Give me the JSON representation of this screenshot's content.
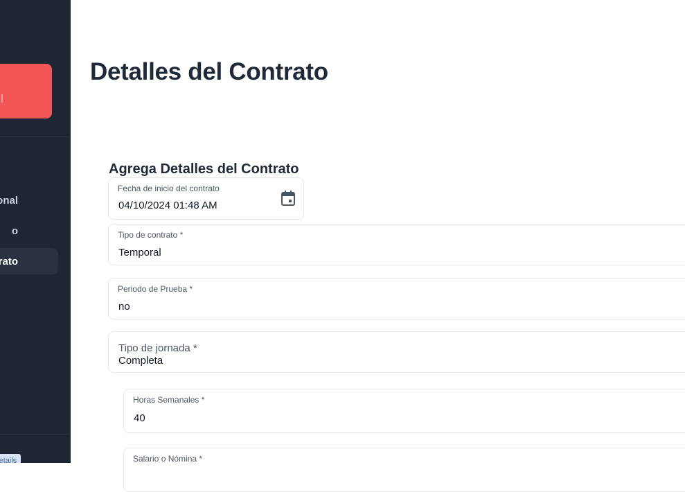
{
  "sidebar": {
    "items": [
      {
        "label": "onal"
      },
      {
        "label": "o"
      },
      {
        "label": "rato"
      }
    ],
    "tag": "actDetails"
  },
  "page": {
    "title": "Detalles del Contrato",
    "section_title": "Agrega Detalles del Contrato"
  },
  "form": {
    "start_date": {
      "label": "Fecha de inicio del contrato",
      "value": "04/10/2024 01:48 AM"
    },
    "contract_type": {
      "label": "Tipo de contrato *",
      "value": "Temporal"
    },
    "trial_period": {
      "label": "Periodo de Prueba *",
      "value": "no"
    },
    "workday_type": {
      "label": "Tipo de jornada *",
      "value": "Completa"
    },
    "weekly_hours": {
      "label": "Horas Semanales *",
      "value": "40"
    },
    "salary": {
      "label": "Salario o Nómina *",
      "value": ""
    }
  },
  "colors": {
    "sidebar_bg": "#1e2533",
    "brand_accent": "#f25555",
    "active_item_bg": "#2a3242"
  }
}
